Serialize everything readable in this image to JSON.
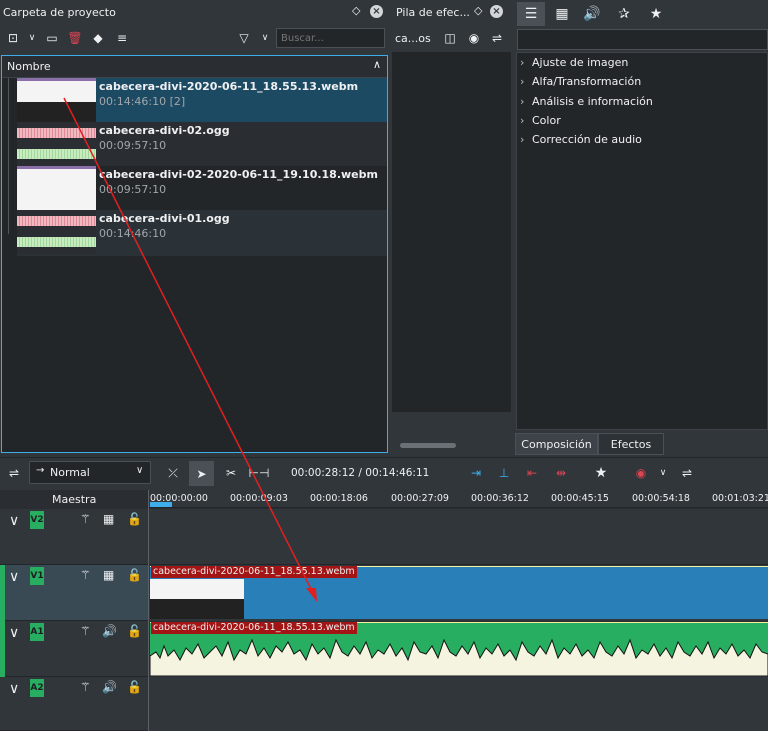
{
  "project_panel": {
    "title": "Carpeta de proyecto",
    "search_placeholder": "Buscar...",
    "column_header": "Nombre",
    "clips": [
      {
        "name": "cabecera-divi-2020-06-11_18.55.13.webm",
        "duration": "00:14:46:10 [2]"
      },
      {
        "name": "cabecera-divi-02.ogg",
        "duration": "00:09:57:10"
      },
      {
        "name": "cabecera-divi-02-2020-06-11_19.10.18.webm",
        "duration": "00:09:57:10"
      },
      {
        "name": "cabecera-divi-01.ogg",
        "duration": "00:14:46:10"
      }
    ]
  },
  "effect_stack": {
    "title": "Pila de efec...",
    "label": "ca...os"
  },
  "effects_panel": {
    "categories": [
      "Ajuste de imagen",
      "Alfa/Transformación",
      "Análisis e información",
      "Color",
      "Corrección de audio"
    ],
    "tabs": [
      "Composición",
      "Efectos"
    ]
  },
  "timeline_toolbar": {
    "mode": "Normal",
    "timecode": "00:00:28:12 / 00:14:46:11"
  },
  "timeline": {
    "master_label": "Maestra",
    "ruler": [
      "00:00:00:00",
      "00:00:09:03",
      "00:00:18:06",
      "00:00:27:09",
      "00:00:36:12",
      "00:00:45:15",
      "00:00:54:18",
      "00:01:03:21"
    ],
    "tracks": [
      {
        "id": "V2"
      },
      {
        "id": "V1",
        "clip": "cabecera-divi-2020-06-11_18.55.13.webm"
      },
      {
        "id": "A1",
        "clip": "cabecera-divi-2020-06-11_18.55.13.webm"
      },
      {
        "id": "A2"
      }
    ]
  },
  "colors": {
    "video_clip": "#2980b9",
    "audio_clip": "#27ae60",
    "selection": "#1d4a63",
    "arrow": "#e02020"
  }
}
